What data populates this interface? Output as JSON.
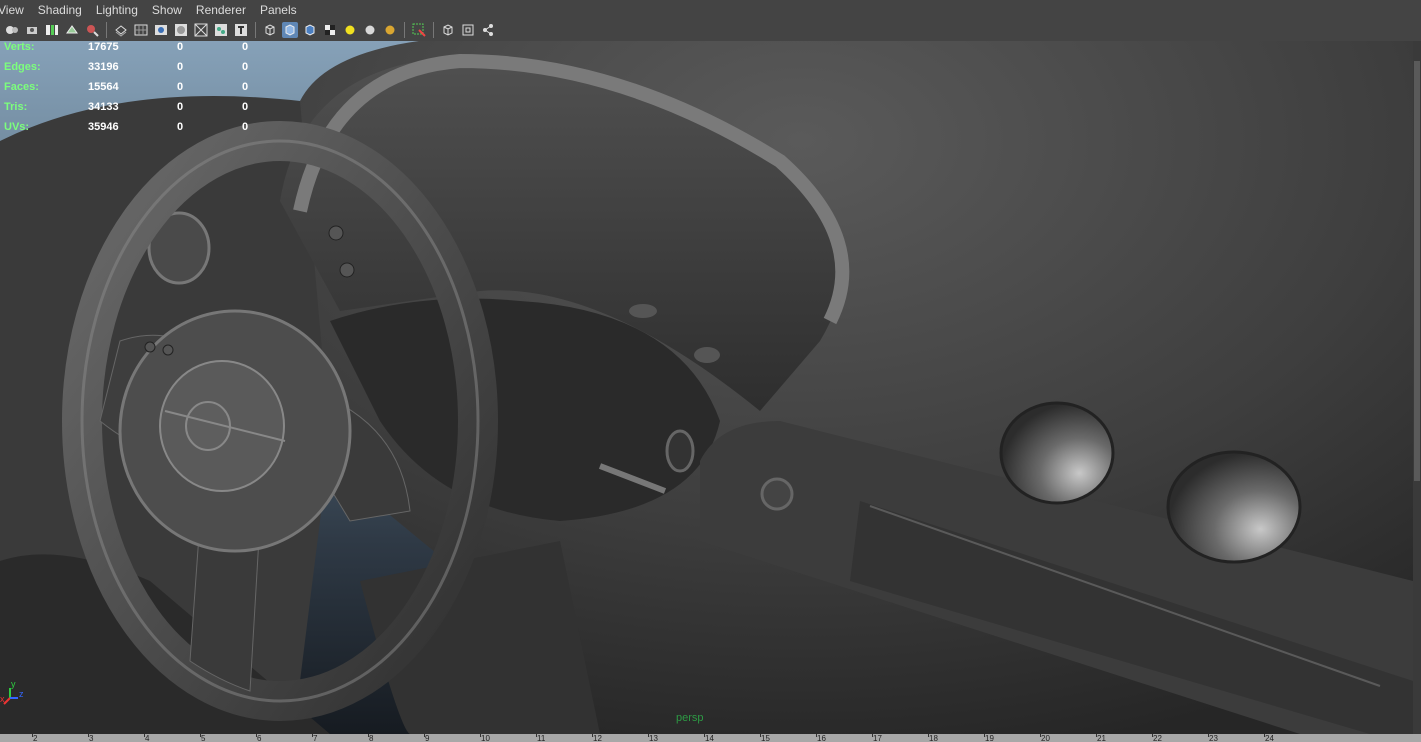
{
  "menu": [
    "View",
    "Shading",
    "Lighting",
    "Show",
    "Renderer",
    "Panels"
  ],
  "toolbar": {
    "icons": [
      "camera-attributes-icon",
      "bookmark-icon",
      "image-plane-icon",
      "grid-icon",
      "film-gate-icon",
      "resolution-gate-icon",
      "wireframe-icon",
      "smooth-shade-icon",
      "textured-icon",
      "lights-icon",
      "xray-icon",
      "isolate-icon",
      "text-icon",
      "wireframe-cube-icon",
      "shaded-cube-icon",
      "textured-cube-icon",
      "checker-icon",
      "default-light-icon",
      "all-lights-icon",
      "flat-light-icon",
      "select-camera-icon",
      "cube-icon",
      "frame-all-icon",
      "graph-icon"
    ],
    "active_icon": "shaded-cube-icon"
  },
  "hud": {
    "rows": [
      {
        "label": "Verts:",
        "v1": "17675",
        "v2": "0",
        "v3": "0"
      },
      {
        "label": "Edges:",
        "v1": "33196",
        "v2": "0",
        "v3": "0"
      },
      {
        "label": "Faces:",
        "v1": "15564",
        "v2": "0",
        "v3": "0"
      },
      {
        "label": "Tris:",
        "v1": "34133",
        "v2": "0",
        "v3": "0"
      },
      {
        "label": "UVs:",
        "v1": "35946",
        "v2": "0",
        "v3": "0"
      }
    ]
  },
  "viewport": {
    "camera": "persp",
    "axis": {
      "x": "x",
      "y": "y",
      "z": "z"
    }
  },
  "timeline": {
    "ticks": [
      "2",
      "3",
      "4",
      "5",
      "6",
      "7",
      "8",
      "9",
      "10",
      "11",
      "12",
      "13",
      "14",
      "15",
      "16",
      "17",
      "18",
      "19",
      "20",
      "21",
      "22",
      "23",
      "24"
    ]
  },
  "colors": {
    "menubar": "#444444",
    "hud_label": "#7cff7c",
    "hud_value": "#ffffff",
    "camera_label": "#2d9a44"
  }
}
